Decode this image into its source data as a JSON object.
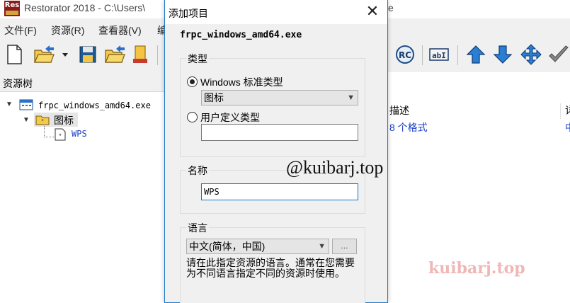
{
  "window": {
    "title": "Restorator 2018 - C:\\Users\\",
    "title_tail": "e",
    "logo_text": "Res"
  },
  "menu": [
    {
      "label": "文件(F)"
    },
    {
      "label": "资源(R)"
    },
    {
      "label": "查看器(V)"
    },
    {
      "label": "编"
    }
  ],
  "tree": {
    "header": "资源树",
    "root": "frpc_windows_amd64.exe",
    "folder": "图标",
    "item": "WPS"
  },
  "list": {
    "col_desc": "描述",
    "col_next": "详",
    "row_desc": "8 个格式",
    "row_next": "中"
  },
  "toolbar": {
    "rc_label": "RC",
    "abi_label": "abI"
  },
  "dialog": {
    "title": "添加项目",
    "close_glyph": "✕",
    "filename": "frpc_windows_amd64.exe",
    "type_group": "类型",
    "radio_standard": "Windows 标准类型",
    "standard_value": "图标",
    "radio_custom": "用户定义类型",
    "custom_value": "",
    "name_group": "名称",
    "name_value": "WPS",
    "lang_group": "语言",
    "lang_value": "中文(简体，中国)",
    "lang_more": "...",
    "lang_help": "请在此指定资源的语言。通常在您需要为不同语言指定不同的资源时使用。"
  },
  "watermarks": {
    "primary": "@kuibarj.top",
    "secondary": "kuibarj.top"
  },
  "colors": {
    "accent": "#1979ca",
    "link_blue": "#1a3ec8",
    "watermark_pink": "#f0b7b7"
  }
}
